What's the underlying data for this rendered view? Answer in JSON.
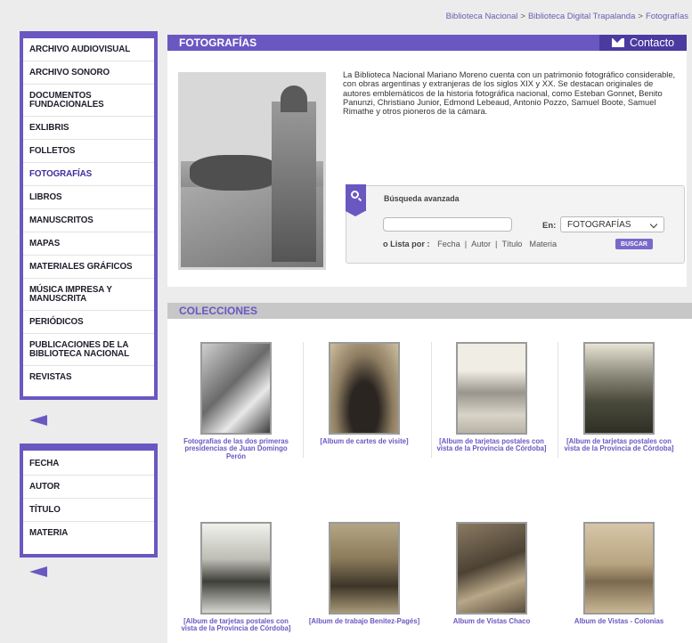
{
  "breadcrumb": [
    "Biblioteca Nacional",
    "Biblioteca Digital Trapalanda",
    "Fotografías"
  ],
  "sidebar": {
    "items": [
      "ARCHIVO AUDIOVISUAL",
      "ARCHIVO SONORO",
      "DOCUMENTOS FUNDACIONALES",
      "EXLIBRIS",
      "FOLLETOS",
      "FOTOGRAFÍAS",
      "LIBROS",
      "MANUSCRITOS",
      "MAPAS",
      "MATERIALES GRÁFICOS",
      "MÚSICA IMPRESA Y MANUSCRITA",
      "PERIÓDICOS",
      "PUBLICACIONES DE LA BIBLIOTECA NACIONAL",
      "REVISTAS"
    ],
    "active_index": 5,
    "filters": [
      "FECHA",
      "AUTOR",
      "TÍTULO",
      "MATERIA"
    ]
  },
  "header": {
    "title": "FOTOGRAFÍAS",
    "contact_label": "Contacto"
  },
  "intro": "La Biblioteca Nacional Mariano Moreno cuenta con un patrimonio fotográfico considerable, con obras argentinas y extranjeras de los siglos XIX y XX. Se destacan originales de autores emblemáticos de la historia fotográfica nacional, como Esteban Gonnet, Benito Panunzi, Christiano Junior, Edmond Lebeaud, Antonio Pozzo, Samuel Boote, Samuel Rimathe y otros pioneros de la cámara.",
  "search": {
    "title": "Búsqueda avanzada",
    "input_value": "",
    "en_label": "En:",
    "select_value": "FOTOGRAFÍAS",
    "lista_label": "o Lista por :",
    "lista_options": [
      "Fecha",
      "Autor",
      "Título",
      "Materia"
    ],
    "buscar_label": "BUSCAR"
  },
  "collections": {
    "title": "COLECCIONES",
    "items": [
      "Fotografías de las dos primeras presidencias de Juan Domingo Perón",
      "[Album de cartes de visite]",
      "[Album de tarjetas postales con vista de la Provincia de Córdoba]",
      "[Album de tarjetas postales con vista de la Provincia de Córdoba]",
      "[Album de tarjetas postales con vista de la Provincia de Córdoba]",
      "[Album de trabajo Benitez-Pagés]",
      "Album de Vistas Chaco",
      "Album de Vistas - Colonias"
    ]
  }
}
